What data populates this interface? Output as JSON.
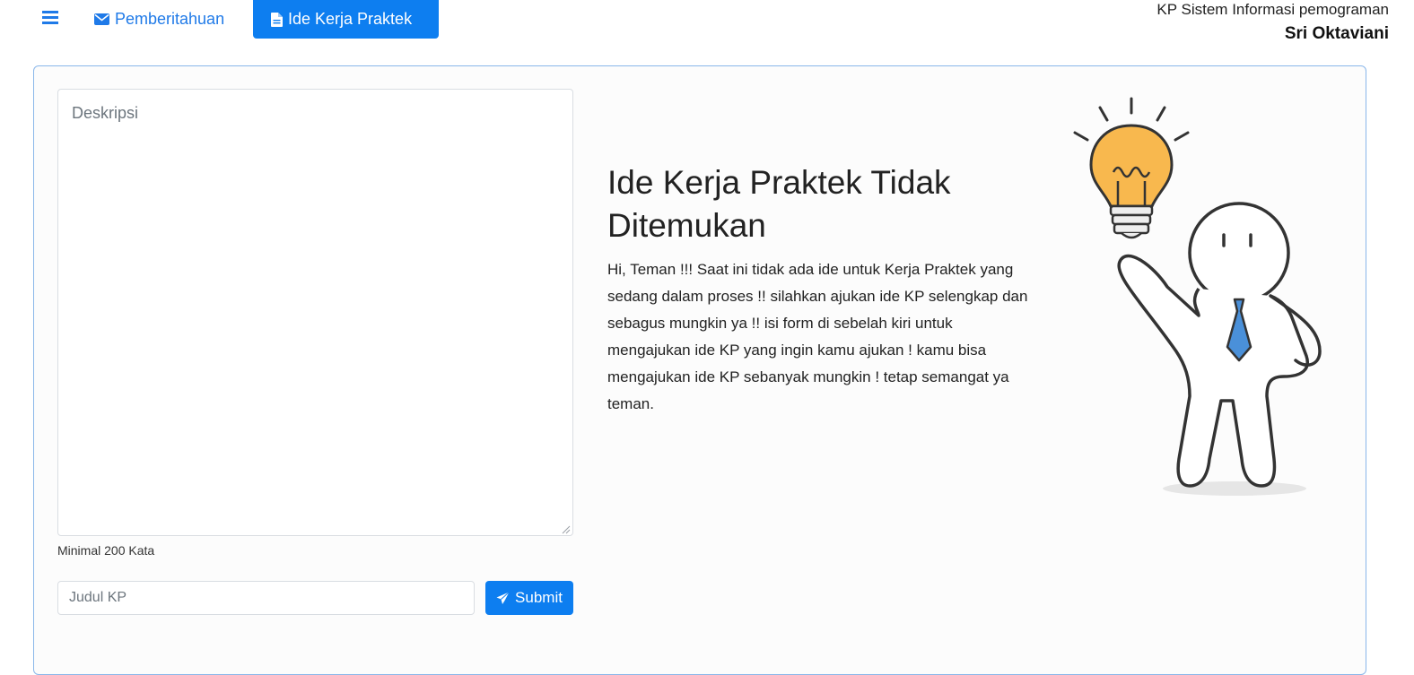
{
  "nav": {
    "menu_icon": "hamburger-menu-icon",
    "notifications": {
      "label": "Pemberitahuan",
      "icon": "envelope-icon"
    },
    "active_tab": {
      "label": "Ide Kerja Praktek",
      "icon": "document-icon"
    }
  },
  "user": {
    "program": "KP Sistem Informasi pemograman",
    "name": "Sri Oktaviani"
  },
  "form": {
    "description_placeholder": "Deskripsi",
    "description_hint": "Minimal 200 Kata",
    "title_placeholder": "Judul KP",
    "submit_label": "Submit",
    "submit_icon": "paper-plane-icon"
  },
  "empty_state": {
    "title": "Ide Kerja Praktek Tidak Ditemukan",
    "message": "Hi, Teman !!! Saat ini tidak ada ide untuk Kerja Praktek yang sedang dalam proses !! silahkan ajukan ide KP selengkap dan sebagus mungkin ya !! isi form di sebelah kiri untuk mengajukan ide KP yang ingin kamu ajukan ! kamu bisa mengajukan ide KP sebanyak mungkin ! tetap semangat ya teman.",
    "illustration": "person-with-lightbulb-illustration"
  },
  "colors": {
    "primary": "#0d7ef0",
    "link": "#1f7ae8",
    "card_border": "#8ab7ea"
  }
}
